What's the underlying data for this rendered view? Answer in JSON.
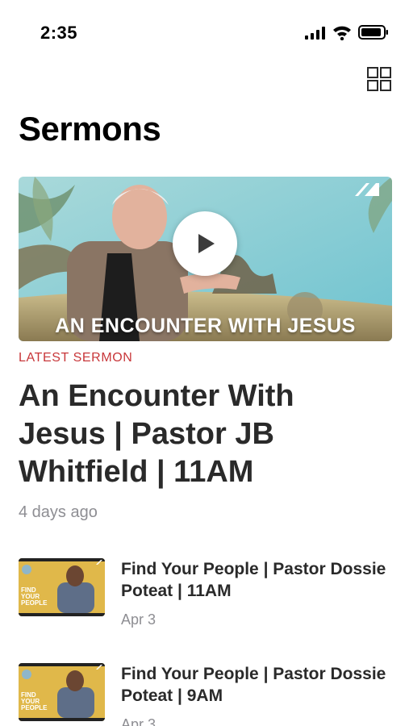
{
  "status_bar": {
    "time": "2:35"
  },
  "page": {
    "title": "Sermons"
  },
  "featured": {
    "image_caption": "AN ENCOUNTER WITH JESUS",
    "label": "LATEST SERMON",
    "title": "An Encounter With Jesus | Pastor JB Whitfield | 11AM",
    "date": "4 days ago"
  },
  "sermons": [
    {
      "title": "Find Your People | Pastor Dossie Poteat | 11AM",
      "date": "Apr 3",
      "thumb_text": "FIND YOUR PEOPLE"
    },
    {
      "title": "Find Your People | Pastor Dossie Poteat | 9AM",
      "date": "Apr 3",
      "thumb_text": "FIND YOUR PEOPLE"
    }
  ],
  "colors": {
    "accent": "#c8373a",
    "thumb_bg": "#e0b84a",
    "hero_sky": "#8fcfd6"
  },
  "icons": [
    "signal-icon",
    "wifi-icon",
    "battery-icon",
    "grid-view-icon",
    "play-icon",
    "channel-logo-icon"
  ]
}
